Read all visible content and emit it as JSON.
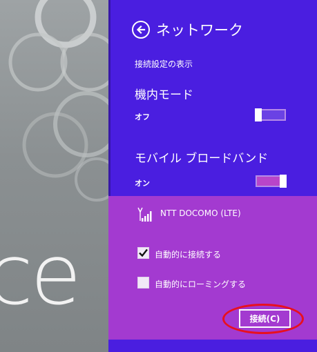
{
  "background": {
    "word": "ce"
  },
  "network": {
    "title": "ネットワーク",
    "settings_link": "接続設定の表示",
    "airplane": {
      "label": "機内モード",
      "state": "オフ",
      "on": false
    },
    "mobile_broadband": {
      "label": "モバイル ブロードバンド",
      "state": "オン",
      "on": true
    },
    "connection": {
      "name": "NTT DOCOMO (LTE)",
      "auto_connect": {
        "label": "自動的に接続する",
        "checked": true
      },
      "auto_roaming": {
        "label": "自動的にローミングする",
        "checked": false
      },
      "connect_button": "接続(C)"
    }
  },
  "colors": {
    "panel": "#4a1ee0",
    "selected_block": "#a33ad0",
    "highlight_ellipse": "#e8101e"
  }
}
